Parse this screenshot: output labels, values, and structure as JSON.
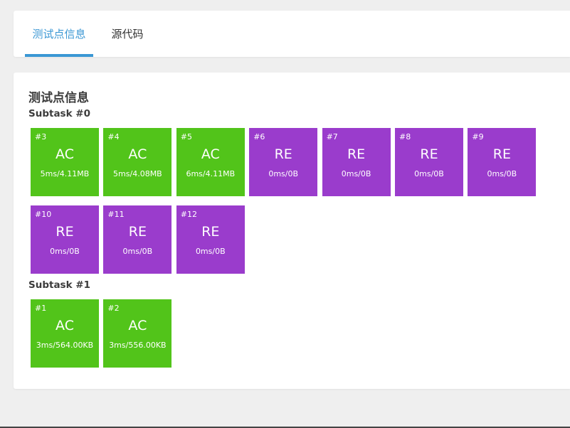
{
  "tabs": [
    {
      "label": "测试点信息",
      "active": true
    },
    {
      "label": "源代码",
      "active": false
    }
  ],
  "section_title": "测试点信息",
  "colors": {
    "accent": "#3a97d4",
    "ac": "#52c41a",
    "re": "#9a3ccc"
  },
  "subtasks": [
    {
      "label": "Subtask #0",
      "cases": [
        {
          "id": "#3",
          "status": "AC",
          "meta": "5ms/4.11MB"
        },
        {
          "id": "#4",
          "status": "AC",
          "meta": "5ms/4.08MB"
        },
        {
          "id": "#5",
          "status": "AC",
          "meta": "6ms/4.11MB"
        },
        {
          "id": "#6",
          "status": "RE",
          "meta": "0ms/0B"
        },
        {
          "id": "#7",
          "status": "RE",
          "meta": "0ms/0B"
        },
        {
          "id": "#8",
          "status": "RE",
          "meta": "0ms/0B"
        },
        {
          "id": "#9",
          "status": "RE",
          "meta": "0ms/0B"
        },
        {
          "id": "#10",
          "status": "RE",
          "meta": "0ms/0B"
        },
        {
          "id": "#11",
          "status": "RE",
          "meta": "0ms/0B"
        },
        {
          "id": "#12",
          "status": "RE",
          "meta": "0ms/0B"
        }
      ]
    },
    {
      "label": "Subtask #1",
      "cases": [
        {
          "id": "#1",
          "status": "AC",
          "meta": "3ms/564.00KB"
        },
        {
          "id": "#2",
          "status": "AC",
          "meta": "3ms/556.00KB"
        }
      ]
    }
  ]
}
